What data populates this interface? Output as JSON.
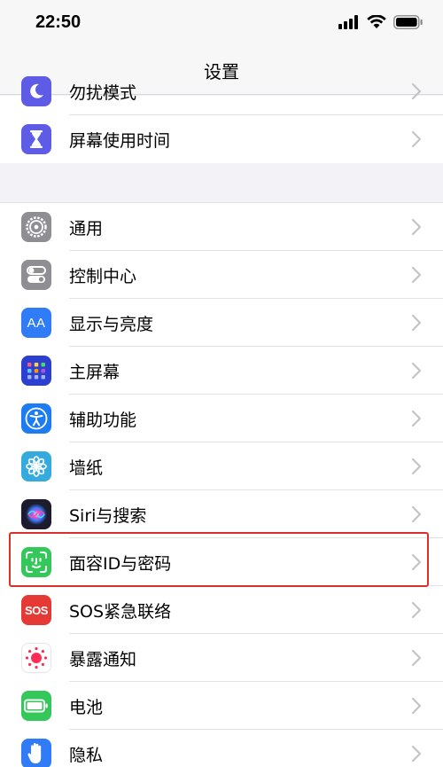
{
  "status": {
    "time": "22:50"
  },
  "nav": {
    "title": "设置"
  },
  "top_group": {
    "partial_label": "勿扰模式",
    "items": [
      {
        "label": "屏幕使用时间",
        "icon": "hourglass-icon",
        "color": "#5e5ce6"
      }
    ]
  },
  "main_group": {
    "items": [
      {
        "label": "通用",
        "icon": "gear-icon",
        "color": "#8e8e93"
      },
      {
        "label": "控制中心",
        "icon": "toggles-icon",
        "color": "#8e8e93"
      },
      {
        "label": "显示与亮度",
        "icon": "text-size-icon",
        "color": "#2f7cf6",
        "icon_text": "AA"
      },
      {
        "label": "主屏幕",
        "icon": "home-grid-icon",
        "color": "#2c3fd0"
      },
      {
        "label": "辅助功能",
        "icon": "accessibility-icon",
        "color": "#1e7cf2"
      },
      {
        "label": "墙纸",
        "icon": "flower-icon",
        "color": "#35aadc"
      },
      {
        "label": "Siri与搜索",
        "icon": "siri-icon",
        "color": "#1c1c2e"
      },
      {
        "label": "面容ID与密码",
        "icon": "face-id-icon",
        "color": "#34c759"
      },
      {
        "label": "SOS紧急联络",
        "icon": "sos-icon",
        "color": "#e53935",
        "icon_text": "SOS"
      },
      {
        "label": "暴露通知",
        "icon": "exposure-icon",
        "color": "#ffffff"
      },
      {
        "label": "电池",
        "icon": "battery-icon",
        "color": "#34c759"
      },
      {
        "label": "隐私",
        "icon": "hand-icon",
        "color": "#2f7cf6"
      }
    ]
  },
  "colors": {
    "highlight": "#d9302a",
    "background": "#f2f2f7"
  }
}
